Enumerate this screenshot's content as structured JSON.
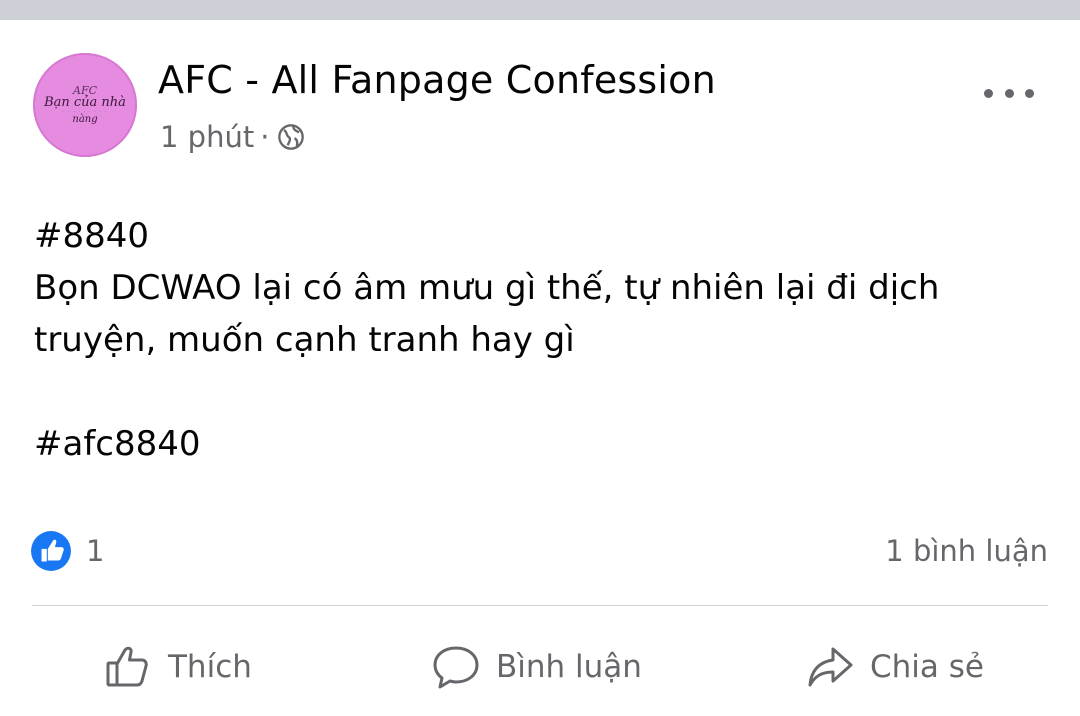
{
  "post": {
    "page_name": "AFC - All Fanpage Confession",
    "time": "1 phút",
    "separator": "·",
    "privacy_icon": "globe-icon",
    "more_icon": "more-horizontal-icon",
    "avatar": {
      "line1": "AFC",
      "line2": "Bạn của nhà",
      "line3": "· · · · · · · · ·",
      "line4": "nàng"
    },
    "content": {
      "hashtag_id": "#8840",
      "line1": "Bọn DCWAO lại có âm mưu gì thế, tự nhiên lại đi dịch",
      "line2": "truyện, muốn cạnh tranh hay gì",
      "hashtag_tag": "#afc8840"
    },
    "reactions": {
      "icon": "like-reaction-icon",
      "count": "1",
      "color": "#1877f2"
    },
    "comments_count": "1 bình luận",
    "actions": {
      "like_label": "Thích",
      "comment_label": "Bình luận",
      "share_label": "Chia sẻ"
    }
  }
}
